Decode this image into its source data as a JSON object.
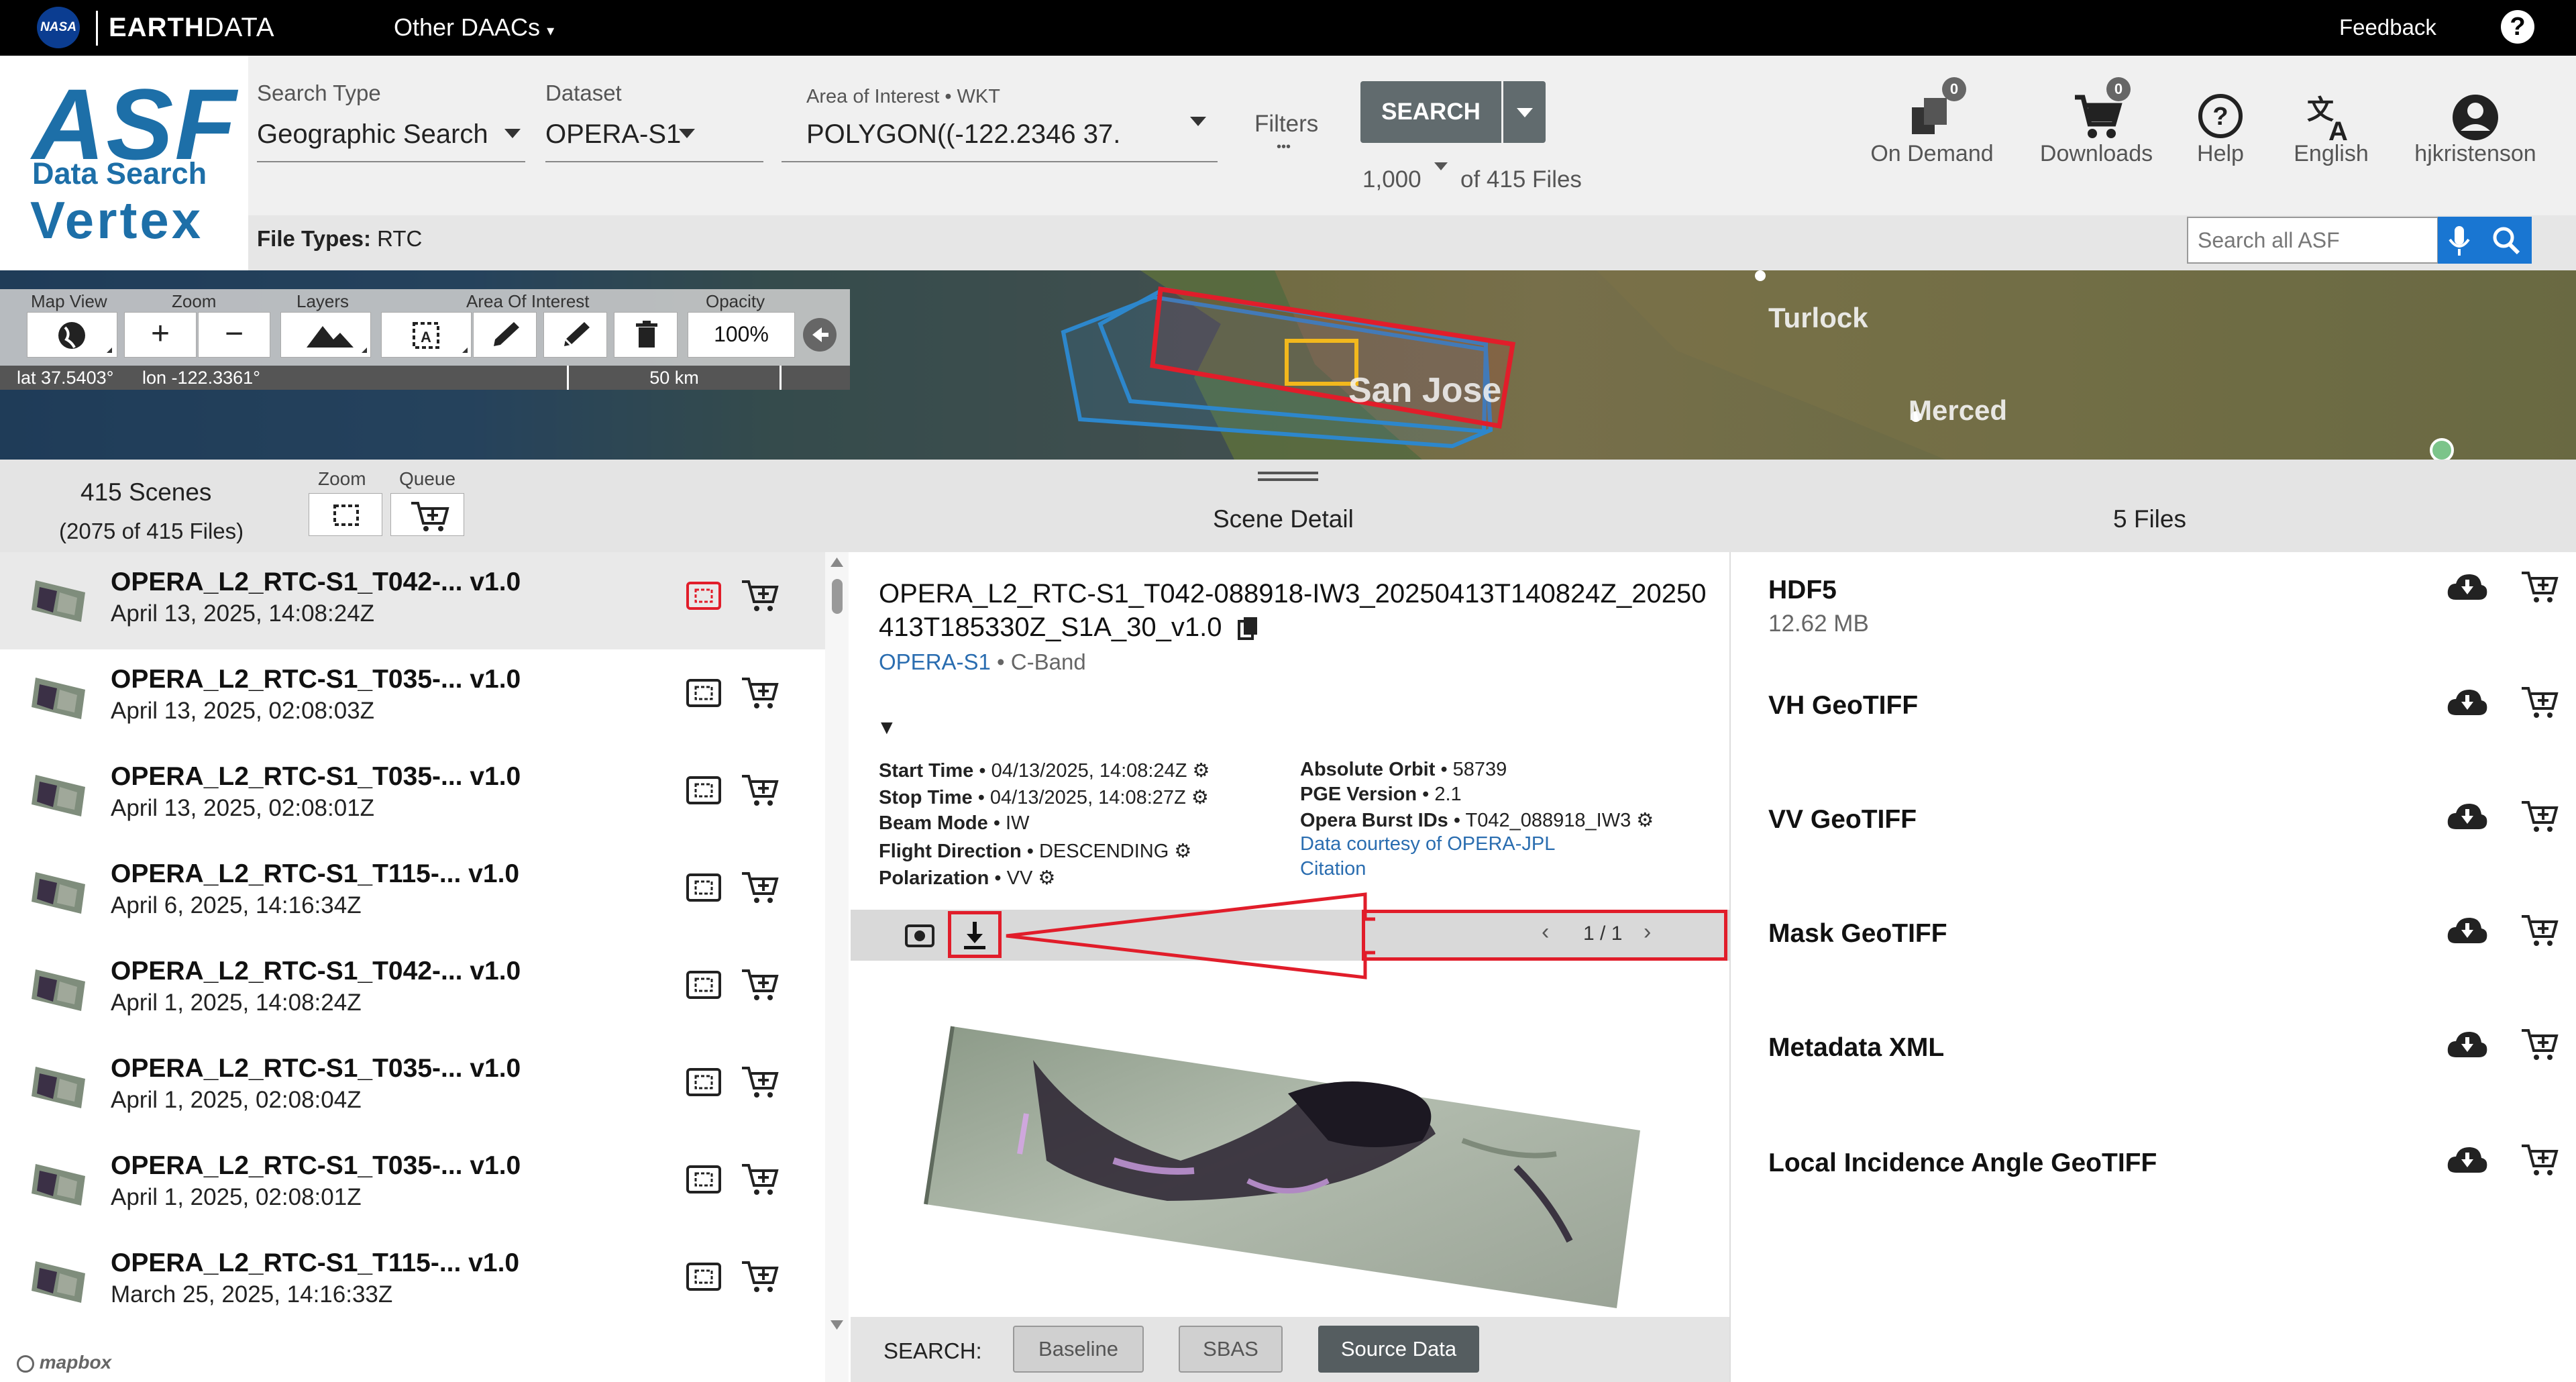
{
  "topbar": {
    "nasa_logo": "NASA",
    "brand_prefix": "EARTH",
    "brand_suffix": "DATA",
    "other_daacs": "Other DAACs",
    "feedback": "Feedback",
    "help": "?"
  },
  "app_logo": {
    "asf": "ASF",
    "data_search": "Data Search",
    "vertex": "Vertex"
  },
  "search_bar": {
    "search_type_label": "Search Type",
    "search_type_value": "Geographic Search",
    "dataset_label": "Dataset",
    "dataset_value": "OPERA-S1",
    "aoi_label": "Area of Interest • WKT",
    "aoi_value": "POLYGON((-122.2346 37.",
    "filters_label": "Filters",
    "filters_dots": "•••",
    "search_button": "SEARCH",
    "max_results": "1,000",
    "of_files": "of 415 Files"
  },
  "header_icons": {
    "on_demand": "On Demand",
    "on_demand_count": "0",
    "downloads": "Downloads",
    "downloads_count": "0",
    "help": "Help",
    "language": "English",
    "user": "hjkristenson"
  },
  "file_types_bar": {
    "label": "File Types:",
    "value": "RTC",
    "search_placeholder": "Search all ASF"
  },
  "map": {
    "map_view_label": "Map View",
    "zoom_label": "Zoom",
    "layers_label": "Layers",
    "aoi_label": "Area Of Interest",
    "opacity_label": "Opacity",
    "zoom_in": "+",
    "zoom_out": "−",
    "opacity_value": "100%",
    "lat": "lat 37.5403°",
    "lon": "lon -122.3361°",
    "scale": "50 km",
    "place_turlock": "Turlock",
    "place_merced": "Merced",
    "place_san_jose": "San Jose",
    "attribution": "mapbox"
  },
  "results_header": {
    "scenes_count": "415 Scenes",
    "files_summary": "(2075 of 415 Files)",
    "zoom_label": "Zoom",
    "queue_label": "Queue",
    "scene_detail": "Scene Detail",
    "files_count": "5 Files"
  },
  "scenes": [
    {
      "name": "OPERA_L2_RTC-S1_T042-... v1.0",
      "date": "April 13, 2025, 14:08:24Z"
    },
    {
      "name": "OPERA_L2_RTC-S1_T035-... v1.0",
      "date": "April 13, 2025, 02:08:03Z"
    },
    {
      "name": "OPERA_L2_RTC-S1_T035-... v1.0",
      "date": "April 13, 2025, 02:08:01Z"
    },
    {
      "name": "OPERA_L2_RTC-S1_T115-... v1.0",
      "date": "April 6, 2025, 14:16:34Z"
    },
    {
      "name": "OPERA_L2_RTC-S1_T042-... v1.0",
      "date": "April 1, 2025, 14:08:24Z"
    },
    {
      "name": "OPERA_L2_RTC-S1_T035-... v1.0",
      "date": "April 1, 2025, 02:08:04Z"
    },
    {
      "name": "OPERA_L2_RTC-S1_T035-... v1.0",
      "date": "April 1, 2025, 02:08:01Z"
    },
    {
      "name": "OPERA_L2_RTC-S1_T115-... v1.0",
      "date": "March 25, 2025, 14:16:33Z"
    }
  ],
  "detail": {
    "title": "OPERA_L2_RTC-S1_T042-088918-IW3_20250413T140824Z_20250413T185330Z_S1A_30_v1.0",
    "dataset_link": "OPERA-S1",
    "band": " • C-Band",
    "collapse": "▼",
    "start_time_label": "Start Time",
    "start_time": " • 04/13/2025, 14:08:24Z",
    "stop_time_label": "Stop Time",
    "stop_time": " • 04/13/2025, 14:08:27Z",
    "beam_mode_label": "Beam Mode",
    "beam_mode": " • IW",
    "flight_direction_label": "Flight Direction",
    "flight_direction": " • DESCENDING",
    "polarization_label": "Polarization",
    "polarization": " • VV",
    "absolute_orbit_label": "Absolute Orbit",
    "absolute_orbit": " • 58739",
    "pge_version_label": "PGE Version",
    "pge_version": " • 2.1",
    "burst_ids_label": "Opera Burst IDs",
    "burst_ids": " • T042_088918_IW3",
    "courtesy": "Data courtesy of OPERA-JPL",
    "citation": "Citation",
    "pager": "1 / 1"
  },
  "search_strip": {
    "label": "SEARCH:",
    "baseline": "Baseline",
    "sbas": "SBAS",
    "source_data": "Source Data"
  },
  "files": [
    {
      "name": "HDF5",
      "size": "12.62 MB"
    },
    {
      "name": "VH GeoTIFF",
      "size": ""
    },
    {
      "name": "VV GeoTIFF",
      "size": ""
    },
    {
      "name": "Mask GeoTIFF",
      "size": ""
    },
    {
      "name": "Metadata XML",
      "size": ""
    },
    {
      "name": "Local Incidence Angle GeoTIFF",
      "size": ""
    }
  ],
  "colors": {
    "brand_blue": "#1d6fa8",
    "highlight_red": "#e11d2a",
    "link_blue": "#2a6db0"
  }
}
